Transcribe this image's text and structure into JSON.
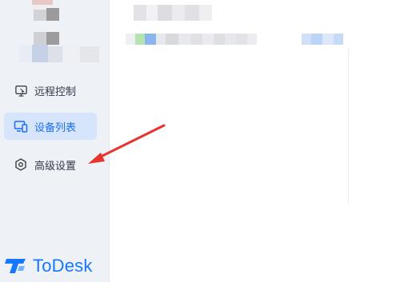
{
  "sidebar": {
    "items": [
      {
        "label": "远程控制",
        "icon": "monitor-icon",
        "active": false
      },
      {
        "label": "设备列表",
        "icon": "devices-icon",
        "active": true
      },
      {
        "label": "高级设置",
        "icon": "settings-icon",
        "active": false
      }
    ],
    "brand": "ToDesk"
  },
  "colors": {
    "accent": "#1677ff",
    "active_bg": "#d6e5fb",
    "annotation_arrow": "#e8342f"
  }
}
